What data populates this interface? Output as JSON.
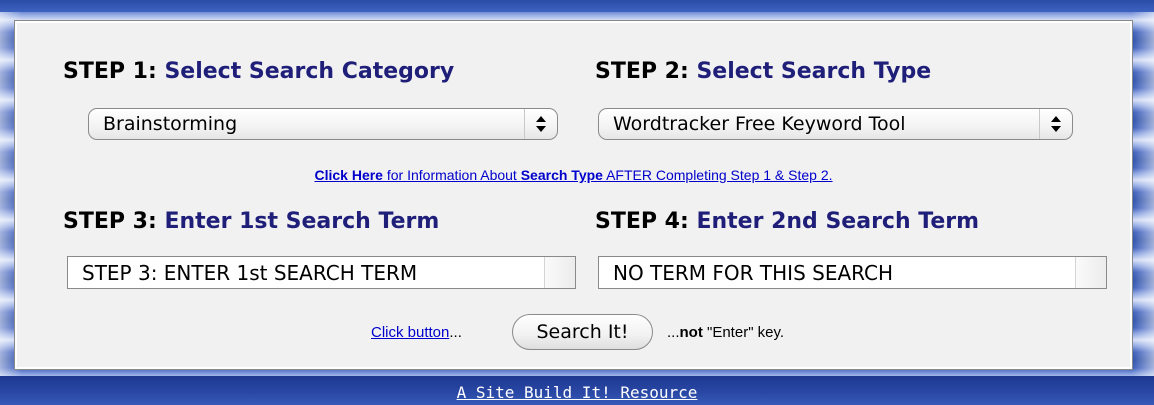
{
  "steps": {
    "step1": {
      "num": "STEP 1:",
      "desc": "Select Search Category"
    },
    "step2": {
      "num": "STEP 2:",
      "desc": "Select Search Type"
    },
    "step3": {
      "num": "STEP 3:",
      "desc": "Enter 1st Search Term"
    },
    "step4": {
      "num": "STEP 4:",
      "desc": "Enter 2nd Search Term"
    }
  },
  "category_select": {
    "value": "Brainstorming"
  },
  "type_select": {
    "value": "Wordtracker Free Keyword Tool"
  },
  "info": {
    "click_here": "Click Here",
    "text1": " for Information About ",
    "search_type": "Search Type",
    "text2": " AFTER Completing Step 1 & Step 2."
  },
  "term1": {
    "value": "STEP 3: ENTER 1st SEARCH TERM"
  },
  "term2": {
    "value": "NO TERM FOR THIS SEARCH"
  },
  "action": {
    "click_button": "Click button",
    "ellipsis1": "...",
    "search_button": "Search It!",
    "ellipsis2": "...",
    "not": "not",
    "enter_key": " \"Enter\" key."
  },
  "footer": {
    "link": "A Site Build It! Resource"
  }
}
